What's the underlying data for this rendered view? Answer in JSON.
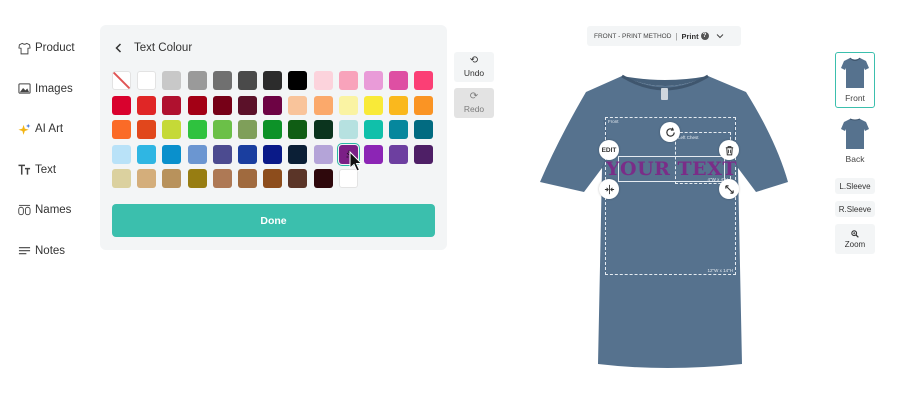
{
  "nav": {
    "items": [
      {
        "label": "Product",
        "icon": "tshirt-icon"
      },
      {
        "label": "Images",
        "icon": "image-icon"
      },
      {
        "label": "AI Art",
        "icon": "sparkle-icon"
      },
      {
        "label": "Text",
        "icon": "text-icon"
      },
      {
        "label": "Names",
        "icon": "numbers-icon"
      },
      {
        "label": "Notes",
        "icon": "lines-icon"
      }
    ]
  },
  "colour_panel": {
    "title": "Text Colour",
    "done_label": "Done",
    "selected_index": 48,
    "swatches": [
      "none",
      "#ffffff",
      "#c8c8c8",
      "#9a9a9a",
      "#707070",
      "#4a4a4a",
      "#2c2c2c",
      "#000000",
      "#fcd3dc",
      "#f8a3bb",
      "#e99bd8",
      "#de4fa3",
      "#fb3f75",
      "#d9022e",
      "#e02626",
      "#b0112f",
      "#a30015",
      "#760017",
      "#5b1129",
      "#6d0344",
      "#f9c49b",
      "#fba96b",
      "#faf3a3",
      "#f9ea38",
      "#fab81d",
      "#fa9424",
      "#fb6b27",
      "#e1471c",
      "#c5d937",
      "#2fc23f",
      "#6bc048",
      "#7f9f5a",
      "#0d9228",
      "#105d14",
      "#0b341e",
      "#b6e1e0",
      "#10c0aa",
      "#06879d",
      "#026b81",
      "#b9e2f8",
      "#2fb6e3",
      "#0a90cc",
      "#6b96d1",
      "#4c4b90",
      "#1a3e9f",
      "#0a1a88",
      "#0b1f36",
      "#b4a4d8",
      "#7b1f86",
      "#8c25b5",
      "#6d3fa0",
      "#4e1f66",
      "#dbd19f",
      "#d4ae7b",
      "#b8925c",
      "#977d12",
      "#ae7955",
      "#a06a3e",
      "#8d4d1c",
      "#5b3528",
      "#2e080c",
      "#ffffff"
    ]
  },
  "history": {
    "undo_label": "Undo",
    "redo_label": "Redo"
  },
  "print_bar": {
    "prefix": "FRONT - PRINT METHOD",
    "separator": "|",
    "method": "Print",
    "info_glyph": "?"
  },
  "design": {
    "text": "YOUR TEXT",
    "text_color": "#7a2d88",
    "shirt_color": "#56728e",
    "edit_label": "EDIT",
    "area_label": "Front",
    "area_size": "12\"W x 14\"H",
    "chest_label": "Left Chest",
    "chest_size": "4\"W x 4\"H"
  },
  "views": {
    "front_label": "Front",
    "back_label": "Back",
    "lsleeve_label": "L.Sleeve",
    "rsleeve_label": "R.Sleeve",
    "zoom_label": "Zoom"
  }
}
